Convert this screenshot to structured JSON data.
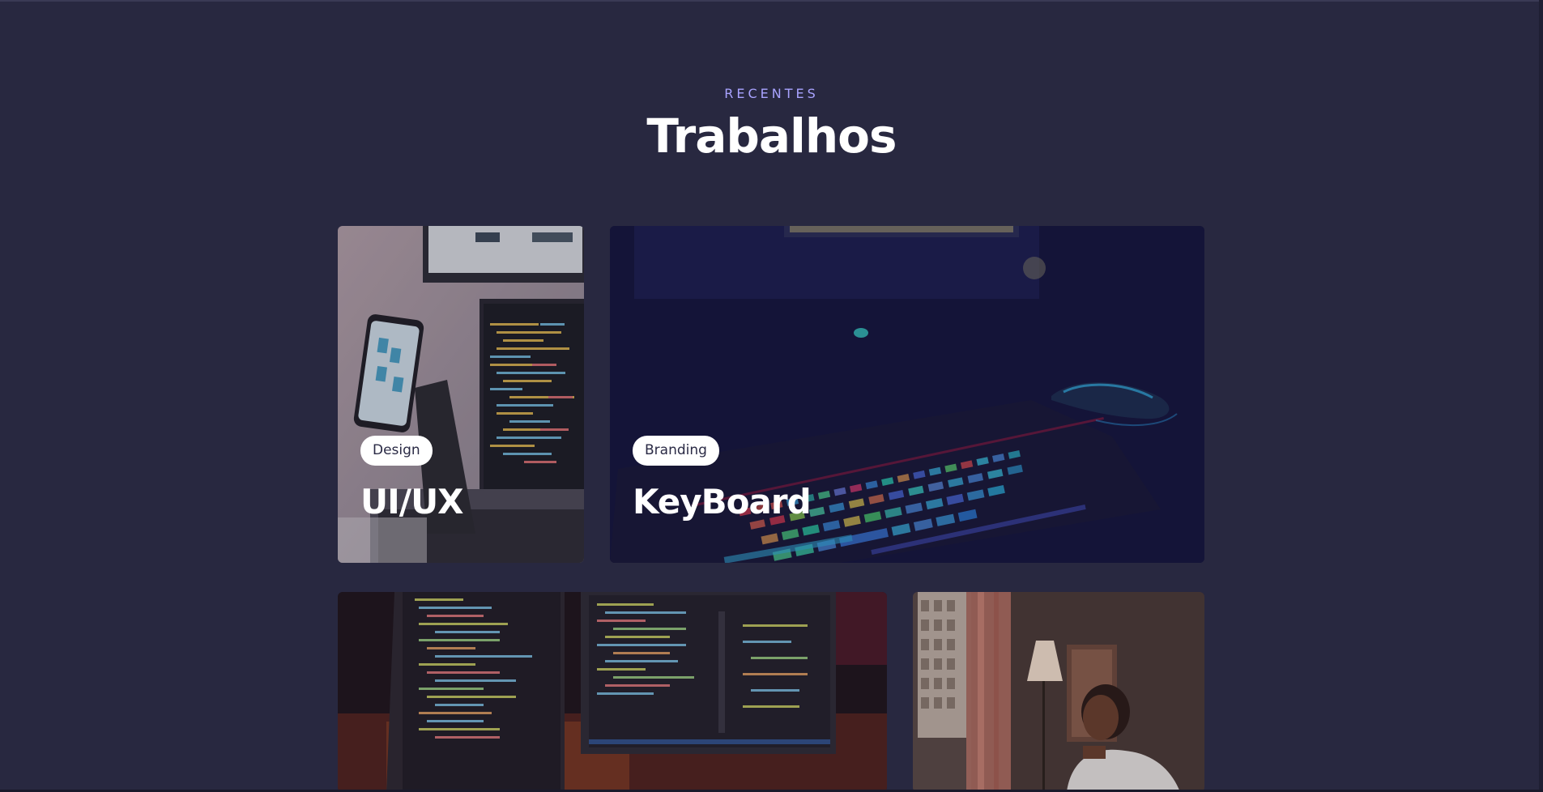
{
  "section": {
    "eyebrow": "RECENTES",
    "title": "Trabalhos"
  },
  "cards": [
    {
      "tag": "Design",
      "title": "UI/UX"
    },
    {
      "tag": "Branding",
      "title": "KeyBoard"
    },
    {
      "tag": "",
      "title": ""
    },
    {
      "tag": "",
      "title": ""
    }
  ],
  "colors": {
    "background": "#282840",
    "accent": "#a9a3ff",
    "overlay": "#161638"
  }
}
